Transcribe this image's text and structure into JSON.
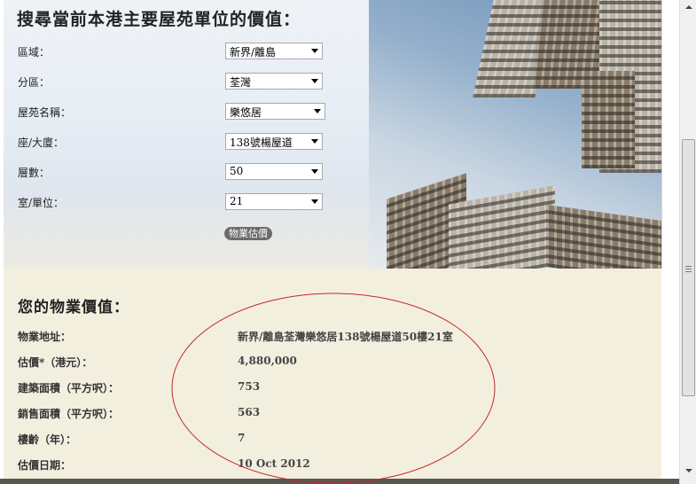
{
  "search": {
    "title": "搜尋當前本港主要屋苑單位的價值：",
    "fields": [
      {
        "label": "區域：",
        "value": "新界/離島"
      },
      {
        "label": "分區：",
        "value": "荃灣"
      },
      {
        "label": "屋苑名稱：",
        "value": "樂悠居"
      },
      {
        "label": "座/大廈：",
        "value": "138號楊屋道"
      },
      {
        "label": "層數：",
        "value": "50"
      },
      {
        "label": "室/單位：",
        "value": "21"
      }
    ],
    "button": "物業估價"
  },
  "result": {
    "title": "您的物業價值：",
    "rows": [
      {
        "label": "物業地址：",
        "value": "新界/離島荃灣樂悠居138號楊屋道50樓21室"
      },
      {
        "label": "估價*（港元）：",
        "value": "4,880,000"
      },
      {
        "label": "建築面積（平方呎）：",
        "value": "753"
      },
      {
        "label": "銷售面積（平方呎）：",
        "value": "563"
      },
      {
        "label": "樓齡（年）：",
        "value": "7"
      },
      {
        "label": "估價日期：",
        "value": "10 Oct 2012"
      }
    ]
  },
  "colors": {
    "annotation": "#c0282d",
    "result_bg": "#f3efdf"
  }
}
